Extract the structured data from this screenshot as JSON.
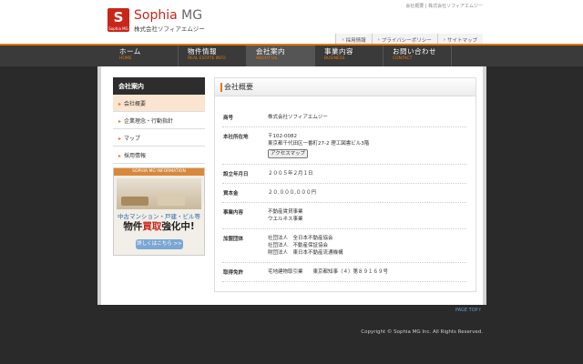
{
  "header": {
    "top_links": "会社概要 | 株式会社ソフィアエムジー",
    "logo": {
      "mark": "S",
      "mark_sub": "Sophia MG",
      "name_part1": "Sophia",
      "name_part2": "MG",
      "company": "株式会社ソフィアエムジー"
    },
    "sub_nav": [
      "採用情報",
      "プライバシーポリシー",
      "サイトマップ"
    ]
  },
  "main_nav": [
    {
      "jp": "ホーム",
      "en": "HOME"
    },
    {
      "jp": "物件情報",
      "en": "REAL ESTATE INFO"
    },
    {
      "jp": "会社案内",
      "en": "ABOUT US"
    },
    {
      "jp": "事業内容",
      "en": "BUSINESS"
    },
    {
      "jp": "お問い合わせ",
      "en": "CONTACT"
    }
  ],
  "sidebar": {
    "title": "会社案内",
    "items": [
      "会社概要",
      "企業理念・行動指針",
      "マップ",
      "採用情報"
    ],
    "banner": {
      "head": "SOPHIA MG INFORMATION",
      "line1": "中古マンション・戸建・ビル等",
      "line2a": "物件",
      "line2b": "買取",
      "line2c": "強化中!",
      "button": "詳しくはこちら >>"
    }
  },
  "main": {
    "title": "会社概要",
    "rows": [
      {
        "label": "商号",
        "lines": [
          "株式会社ソフィアエムジー"
        ]
      },
      {
        "label": "本社所在地",
        "lines": [
          "〒102-0082",
          "東京都千代田区一番町27-2 理工図書ビル3階"
        ],
        "button": "アクセスマップ"
      },
      {
        "label": "設立年月日",
        "lines": [
          "２００５年２月１日"
        ]
      },
      {
        "label": "資本金",
        "lines": [
          "２０,０００,０００円"
        ]
      },
      {
        "label": "事業内容",
        "lines": [
          "不動産賃貸事業",
          "ウエルネス事業"
        ]
      },
      {
        "label": "加盟団体",
        "lines": [
          "社団法人　全日本不動産協会",
          "社団法人　不動産保証協会",
          "財団法人　東日本不動産流通機構"
        ]
      },
      {
        "label": "取得免許",
        "lines": [
          "宅地建物取引業　　東京都知事（４）第８９１６９号"
        ]
      }
    ]
  },
  "page_top": "PAGE TOP↑",
  "footer": {
    "copyright": "Copyright © Sophia MG Inc. All Rights Reserved."
  },
  "colors": {
    "brand_red": "#c8261a",
    "accent_orange": "#e07a10",
    "nav_bg": "#3a3a3a"
  }
}
